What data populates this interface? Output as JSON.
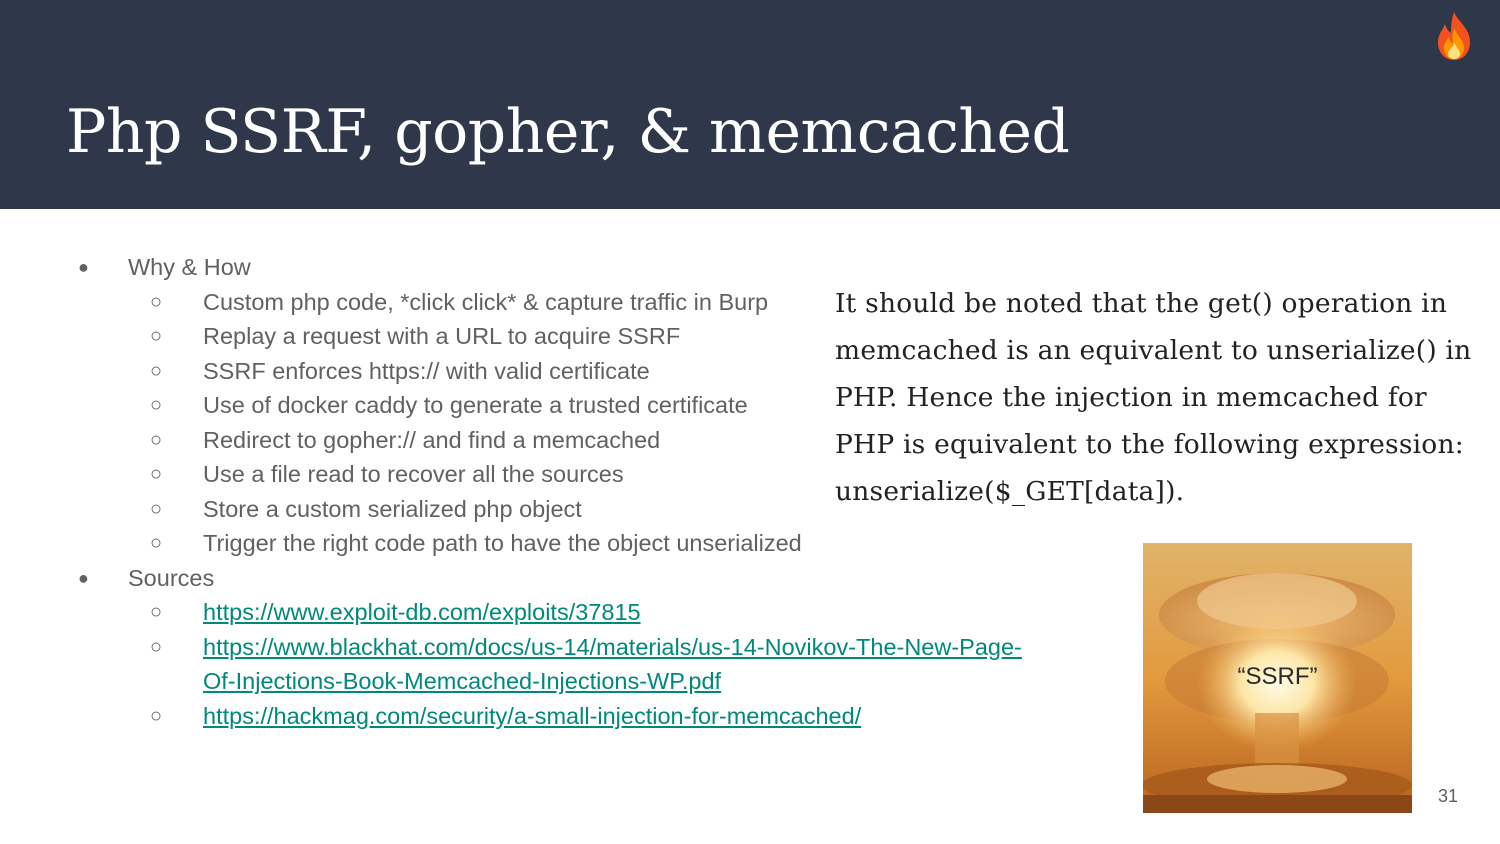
{
  "slide": {
    "title": "Php SSRF, gopher, & memcached",
    "page_number": "31"
  },
  "bullets": [
    {
      "text": "Why & How",
      "children": [
        "Custom php code, *click click* & capture traffic in Burp",
        "Replay a request with a URL to acquire SSRF",
        "SSRF enforces https:// with valid certificate",
        "Use of docker caddy to generate a trusted certificate",
        "Redirect to gopher:// and find a memcached",
        "Use a file read to recover all the sources",
        "Store a custom serialized php object",
        "Trigger the right code path to have the object unserialized"
      ]
    },
    {
      "text": "Sources",
      "links": [
        "https://www.exploit-db.com/exploits/37815",
        "https://www.blackhat.com/docs/us-14/materials/us-14-Novikov-The-New-Page-Of-Injections-Book-Memcached-Injections-WP.pdf",
        "https://hackmag.com/security/a-small-injection-for-memcached/"
      ]
    }
  ],
  "quote_image": {
    "lines": [
      "It should be noted that the get() operation in",
      "memcached is an equivalent to unserialize() in",
      "PHP. Hence the injection in memcached for",
      "PHP is equivalent to the following expression:",
      "unserialize($_GET[data])."
    ]
  },
  "explosion_image": {
    "caption": "“SSRF”"
  },
  "icons": {
    "logo": "fire-icon",
    "bullet_level1": "filled-circle",
    "bullet_level2": "hollow-circle"
  },
  "colors": {
    "header_bg": "#2f384b",
    "title": "#ffffff",
    "body_text": "#616161",
    "link": "#00897b"
  }
}
